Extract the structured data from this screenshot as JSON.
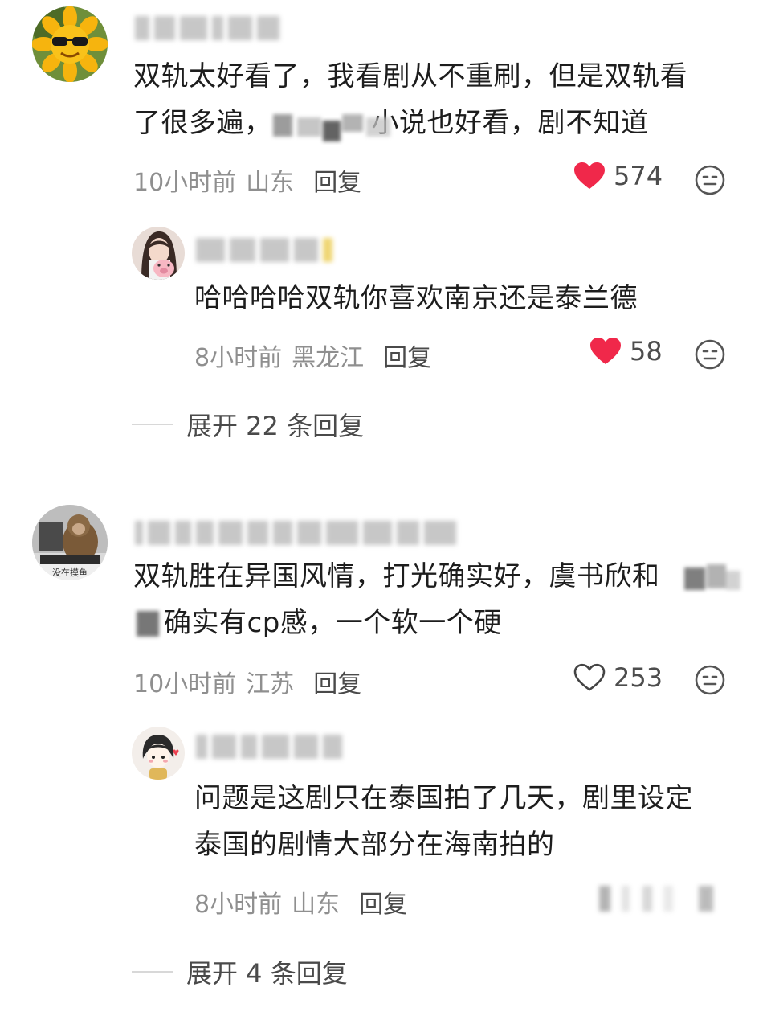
{
  "comments": [
    {
      "avatar_icon": "sunflower-sunglasses-avatar",
      "text_lines": [
        "双轨太好看了，我看剧从不重刷，但是双轨看",
        "了很多遍，",
        "小说也好看，剧不知道"
      ],
      "time": "10小时前",
      "location": "山东",
      "reply_label": "回复",
      "likes": "574",
      "liked": true,
      "reply": {
        "avatar_icon": "girl-with-pig-avatar",
        "text_lines": [
          "哈哈哈哈双轨你喜欢南京还是泰兰德"
        ],
        "time": "8小时前",
        "location": "黑龙江",
        "reply_label": "回复",
        "likes": "58",
        "liked": true
      },
      "expand_label": "展开 22 条回复"
    },
    {
      "avatar_icon": "monkey-at-computer-avatar",
      "avatar_caption": "没在摸鱼",
      "text_lines": [
        "双轨胜在异国风情，打光确实好，虞书欣和",
        "确实有cp感，一个软一个硬"
      ],
      "time": "10小时前",
      "location": "江苏",
      "reply_label": "回复",
      "likes": "253",
      "liked": false,
      "reply": {
        "avatar_icon": "cartoon-girl-avatar",
        "text_lines": [
          "问题是这剧只在泰国拍了几天，剧里设定",
          "泰国的剧情大部分在海南拍的"
        ],
        "time": "8小时前",
        "location": "山东",
        "reply_label": "回复"
      },
      "expand_label": "展开 4 条回复"
    }
  ],
  "colors": {
    "like_red": "#f0284a",
    "meta_gray": "#8f8f8f",
    "text_dark": "#1d1d1d"
  }
}
